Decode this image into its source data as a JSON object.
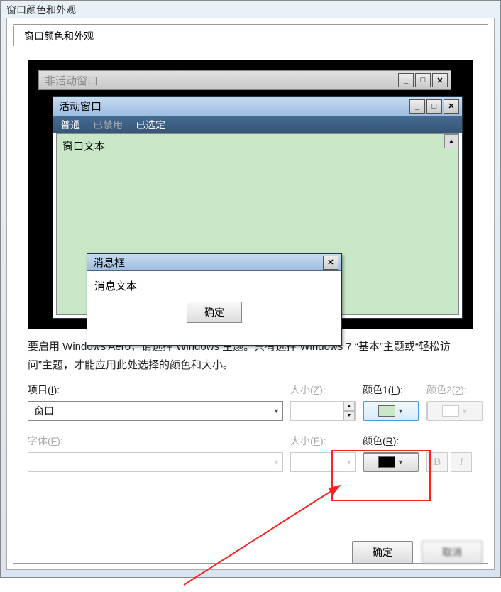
{
  "window": {
    "title_fragment": "窗口颜色和外观"
  },
  "tab": {
    "label": "窗口颜色和外观"
  },
  "preview": {
    "inactive_title": "非活动窗口",
    "active_title": "活动窗口",
    "menu_normal": "普通",
    "menu_disabled": "已禁用",
    "menu_selected": "已选定",
    "window_text": "窗口文本",
    "msgbox_title": "消息框",
    "msgbox_text": "消息文本",
    "msgbox_ok": "确定"
  },
  "description": "要启用 Windows Aero，请选择 Windows 主题。只有选择 Windows 7 “基本”主题或“轻松访问”主题，才能应用此处选择的颜色和大小。",
  "labels": {
    "item": "项目(I):",
    "size": "大小(Z):",
    "color1": "颜色1(L):",
    "color2": "颜色2(2):",
    "font": "字体(F):",
    "fsize": "大小(E):",
    "fcolor": "颜色(R):"
  },
  "values": {
    "item_selected": "窗口"
  },
  "colors": {
    "color1_swatch": "#c8e8c8",
    "color2_swatch": "#ffffff",
    "fcolor_swatch": "#000000"
  },
  "buttons": {
    "ok": "确定",
    "cancel": "取消",
    "bold": "B",
    "italic": "I"
  }
}
